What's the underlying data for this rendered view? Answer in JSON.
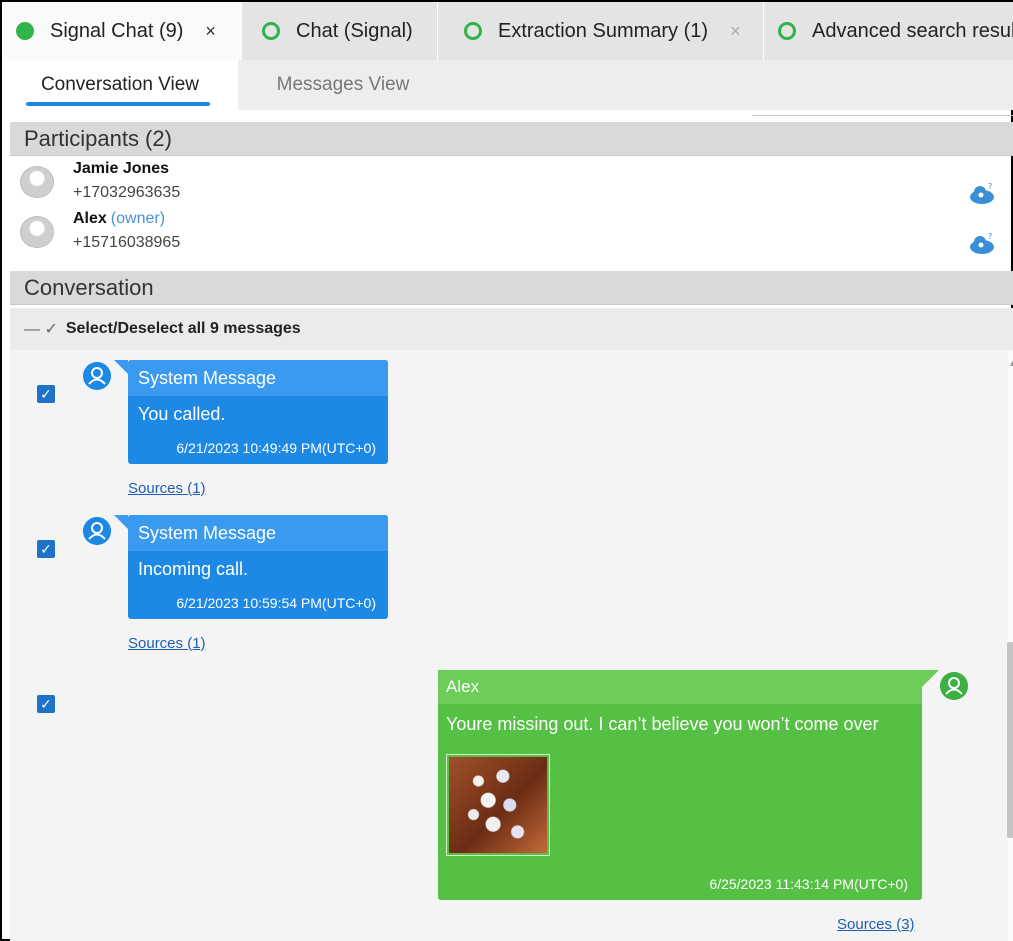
{
  "tabs": [
    {
      "label": "Signal Chat",
      "count": "(9)",
      "close": "×"
    },
    {
      "label": "Chat (Signal)"
    },
    {
      "label": "Extraction Summary (1)",
      "close": "×"
    },
    {
      "label": "Advanced search resul"
    }
  ],
  "subtabs": {
    "conversation": "Conversation View",
    "messages": "Messages View"
  },
  "participants": {
    "title": "Participants (2)",
    "items": [
      {
        "name": "Jamie Jones",
        "role": "",
        "phone": "+17032963635"
      },
      {
        "name": "Alex",
        "role": "(owner)",
        "phone": "+15716038965"
      }
    ]
  },
  "conversation": {
    "title": "Conversation",
    "select_all_marks": "— ✓",
    "select_all": "Select/Deselect all 9 messages",
    "messages": [
      {
        "sender": "System Message",
        "text": "You called.",
        "time": "6/21/2023 10:49:49 PM(UTC+0)",
        "sources": "Sources (1)"
      },
      {
        "sender": "System Message",
        "text": "Incoming call.",
        "time": "6/21/2023 10:59:54 PM(UTC+0)",
        "sources": "Sources (1)"
      },
      {
        "sender": "Alex",
        "text": "Youre missing out. I can’t believe you won’t come over",
        "time": "6/25/2023 11:43:14 PM(UTC+0)",
        "sources": "Sources (3)"
      }
    ],
    "check_mark": "✓"
  },
  "colors": {
    "accent": "#1e88e5",
    "outgoing": "#55c043",
    "status_dot": "#2fb44a"
  }
}
